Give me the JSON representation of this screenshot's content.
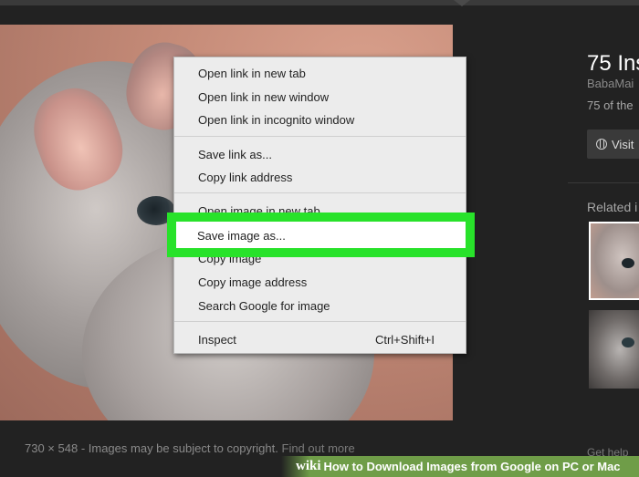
{
  "result": {
    "title": "75 Ins",
    "source": "BabaMai",
    "description": "75 of the",
    "visit_label": "Visit",
    "related_label": "Related i"
  },
  "context_menu": {
    "items": [
      "Open link in new tab",
      "Open link in new window",
      "Open link in incognito window",
      "Save link as...",
      "Copy link address",
      "Open image in new tab",
      "Save image as...",
      "Copy image",
      "Copy image address",
      "Search Google for image",
      "Inspect"
    ],
    "inspect_shortcut": "Ctrl+Shift+I"
  },
  "caption": {
    "dimensions": "730 × 548",
    "separator": " - ",
    "notice": "Images may be subject to copyright.",
    "find_out_more": "Find out more"
  },
  "footer": {
    "get_help": "Get help"
  },
  "banner": {
    "logo": "wiki",
    "title": "How to Download Images from Google on PC or Mac"
  }
}
